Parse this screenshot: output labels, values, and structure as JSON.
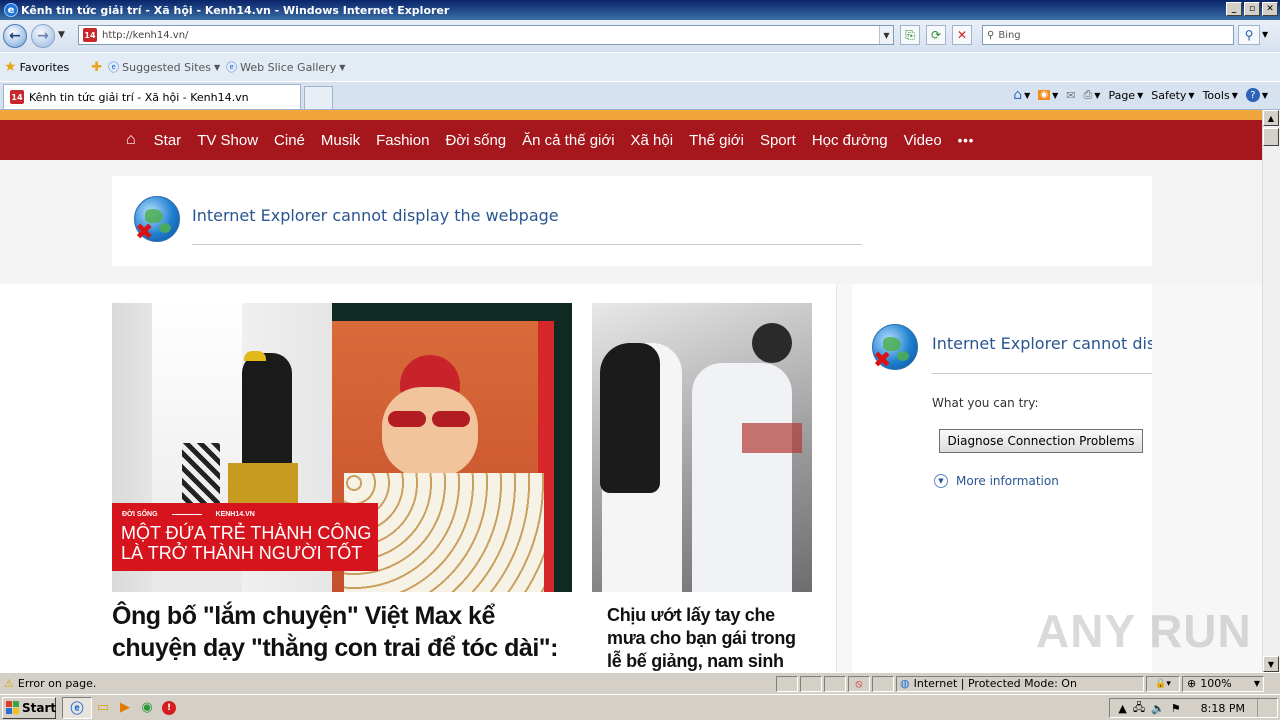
{
  "window": {
    "title": "Kênh tin tức giải trí - Xã hội - Kenh14.vn - Windows Internet Explorer"
  },
  "address": {
    "url": "http://kenh14.vn/",
    "site_icon": "14"
  },
  "search": {
    "placeholder": "Bing"
  },
  "favorites": {
    "label": "Favorites",
    "items": [
      {
        "label": "Suggested Sites"
      },
      {
        "label": "Web Slice Gallery"
      }
    ]
  },
  "tab": {
    "label": "Kênh tin tức giải trí - Xã hội - Kenh14.vn"
  },
  "commandbar": {
    "page": "Page",
    "safety": "Safety",
    "tools": "Tools"
  },
  "site": {
    "menu": [
      "Star",
      "TV Show",
      "Ciné",
      "Musik",
      "Fashion",
      "Đời sống",
      "Ăn cả thế giới",
      "Xã hội",
      "Thế giới",
      "Sport",
      "Học đường",
      "Video"
    ],
    "menu_more": "•••"
  },
  "error1": {
    "title": "Internet Explorer cannot display the webpage"
  },
  "hero": {
    "overlay_category": "ĐỜI SỐNG",
    "overlay_source": "KENH14.VN",
    "overlay_line1": "MỘT ĐỨA TRẺ THÀNH CÔNG",
    "overlay_line2": "LÀ TRỞ THÀNH NGƯỜI TỐT",
    "headline": "Ông bố \"lắm chuyện\" Việt Max kể chuyện dạy \"thằng con trai để tóc dài\":",
    "side_headline": "Chịu ướt lấy tay che mưa cho bạn gái trong lễ bế giảng, nam sinh"
  },
  "error2": {
    "title": "Internet Explorer cannot disp",
    "try": "What you can try:",
    "button": "Diagnose Connection Problems",
    "more": "More information"
  },
  "status": {
    "text": "Error on page.",
    "zone": "Internet | Protected Mode: On",
    "zoom": "100%"
  },
  "taskbar": {
    "start": "Start",
    "time": "8:18 PM"
  },
  "watermark": "ANY RUN"
}
